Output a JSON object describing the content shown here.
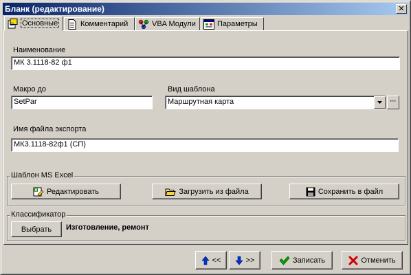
{
  "window": {
    "title": "Бланк (редактирование)",
    "close_glyph": "✕"
  },
  "tabs": [
    {
      "label": "Основные",
      "icon": "form-icon",
      "active": true
    },
    {
      "label": "Комментарий",
      "icon": "document-icon",
      "active": false
    },
    {
      "label": "VBA Модули",
      "icon": "modules-icon",
      "active": false
    },
    {
      "label": "Параметры",
      "icon": "parameters-icon",
      "active": false
    }
  ],
  "form": {
    "name_label": "Наименование",
    "name_value": "МК 3.1118-82 ф1",
    "macro_label": "Макро до",
    "macro_value": "SetPar",
    "template_label": "Вид шаблона",
    "template_value": "Маршрутная карта",
    "ellipsis": "···",
    "export_label": "Имя файла экспорта",
    "export_value": "МК3.1118-82ф1 (СП)"
  },
  "excel_group": {
    "title": "Шаблон MS Excel",
    "edit_label": "Редактировать",
    "load_label": "Загрузить из файла",
    "save_label": "Сохранить в файл"
  },
  "classifier_group": {
    "title": "Классификатор",
    "select_label": "Выбрать",
    "value": "Изготовление, ремонт"
  },
  "footer": {
    "prev_label": "<<",
    "next_label": ">>",
    "write_label": "Записать",
    "cancel_label": "Отменить"
  },
  "colors": {
    "titlebar_start": "#0a246a",
    "titlebar_end": "#a6caf0",
    "face": "#d4d0c8",
    "accept_green": "#00a000",
    "cancel_red": "#d00000",
    "arrow_blue": "#0033cc"
  }
}
